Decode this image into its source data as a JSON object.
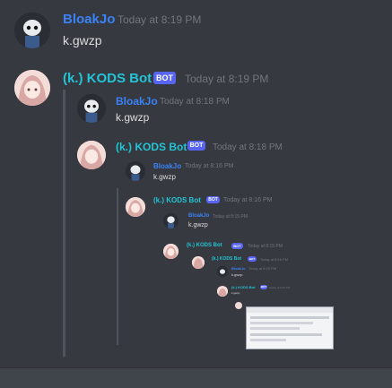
{
  "messages": {
    "m1": {
      "author": "BloakJo",
      "time": "Today at 8:19 PM",
      "text": "k.gwzp"
    },
    "m2": {
      "author": "(k.) KODS Bot",
      "badge": "BOT",
      "time": "Today at 8:19 PM"
    },
    "n1": {
      "author": "BloakJo",
      "time": "Today at 8:18 PM",
      "text": "k.gwzp"
    },
    "n2": {
      "author": "(k.) KODS Bot",
      "badge": "BOT",
      "time": "Today at 8:18 PM"
    },
    "n3": {
      "author": "BloakJo",
      "time": "Today at 8:16 PM",
      "text": "k.gwzp"
    },
    "n4": {
      "author": "(k.) KODS Bot",
      "badge": "BOT",
      "time": "Today at 8:16 PM"
    },
    "n5": {
      "author": "BloakJo",
      "time": "Today at 8:15 PM",
      "text": "k.gwzp"
    },
    "n6": {
      "author": "(k.) KODS Bot",
      "badge": "BOT",
      "time": "Today at 8:15 PM"
    },
    "n7": {
      "author": "(k.) KODS Bot",
      "badge": "BOT",
      "time": "Today at 8:15 PM"
    },
    "n8": {
      "author": "BloakJo",
      "time": "Today at 8:15 PM",
      "text": "k.gwzp"
    },
    "n9": {
      "author": "(k.) KODS Bot",
      "badge": "BOT",
      "time": "Today at 8:15 PM",
      "text": "k.gwzp"
    }
  },
  "colors": {
    "background": "#36393f",
    "username_user": "#3b82f6",
    "username_bot": "#22c4d6",
    "bot_badge": "#5865f2"
  }
}
